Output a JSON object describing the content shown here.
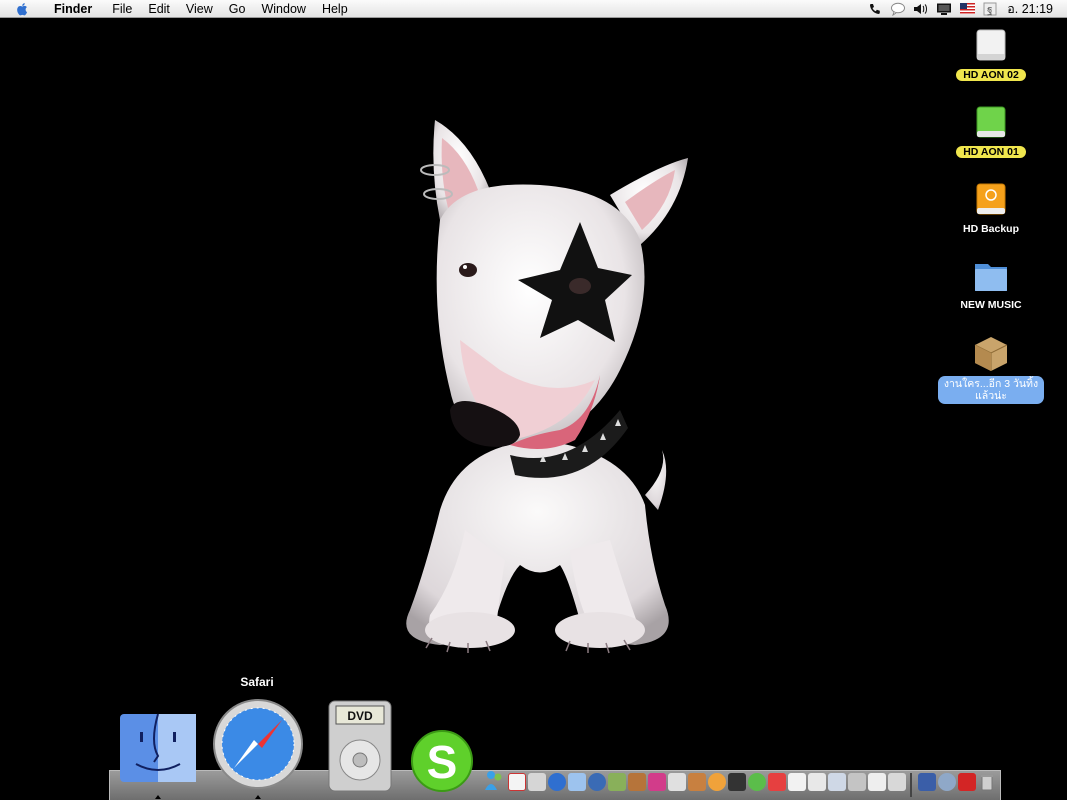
{
  "menubar": {
    "app_name": "Finder",
    "menus": [
      "File",
      "Edit",
      "View",
      "Go",
      "Window",
      "Help"
    ],
    "extras": [
      "phone-icon",
      "ichat-icon",
      "volume-icon",
      "display-icon",
      "flag-us-icon",
      "thai-input-icon"
    ],
    "clock": "อ. 21:19"
  },
  "desktop": {
    "icons": [
      {
        "label": "HD AON 02",
        "icon": "drive-icon"
      },
      {
        "label": "HD AON 01",
        "icon": "green-drive-icon"
      },
      {
        "label": "HD Backup",
        "icon": "firewire-drive-icon"
      },
      {
        "label": "NEW MUSIC",
        "icon": "folder-icon"
      },
      {
        "label": "งานใคร...อีก 3 วันทิ้งแล้วน่ะ",
        "icon": "package-icon"
      }
    ]
  },
  "dock": {
    "tooltip": "Safari",
    "apps": [
      "finder-icon",
      "safari-icon",
      "dvd-player-icon",
      "skype-icon"
    ],
    "dvd_label": "DVD"
  },
  "colors": {
    "desktop": "#000000",
    "label_yellow": "#f0e64d",
    "label_selected": "#7aaef0"
  }
}
